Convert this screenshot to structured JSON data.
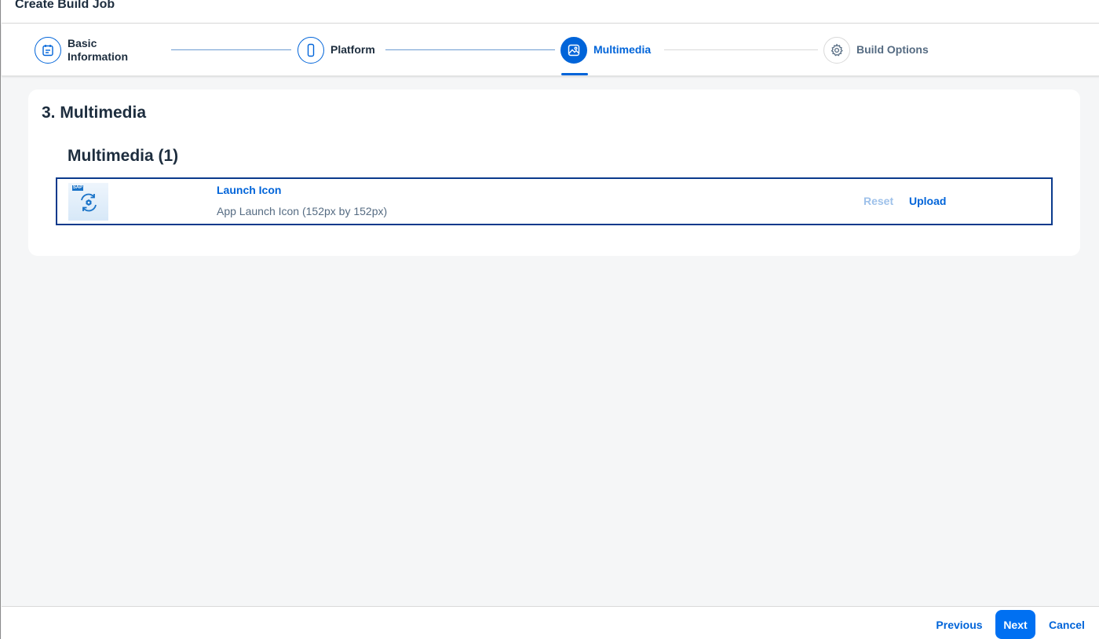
{
  "window": {
    "title": "Create Build Job"
  },
  "wizard": {
    "steps": [
      {
        "label_line1": "Basic",
        "label_line2": "Information",
        "icon": "calendar-icon",
        "state": "completed"
      },
      {
        "label": "Platform",
        "icon": "phone-icon",
        "state": "completed"
      },
      {
        "label": "Multimedia",
        "icon": "image-icon",
        "state": "active"
      },
      {
        "label": "Build Options",
        "icon": "gear-icon",
        "state": "future"
      }
    ]
  },
  "main": {
    "section_title": "3. Multimedia",
    "list_title": "Multimedia (1)",
    "items": [
      {
        "title": "Launch Icon",
        "description": "App Launch Icon (152px by 152px)",
        "thumbnail_badge": "SAP",
        "reset_label": "Reset",
        "upload_label": "Upload"
      }
    ]
  },
  "footer": {
    "previous_label": "Previous",
    "next_label": "Next",
    "cancel_label": "Cancel"
  },
  "colors": {
    "accent": "#0064d9",
    "emphasized_button": "#0070f2",
    "selected_row_border": "#0a3a8c",
    "background": "#f5f6f7"
  }
}
